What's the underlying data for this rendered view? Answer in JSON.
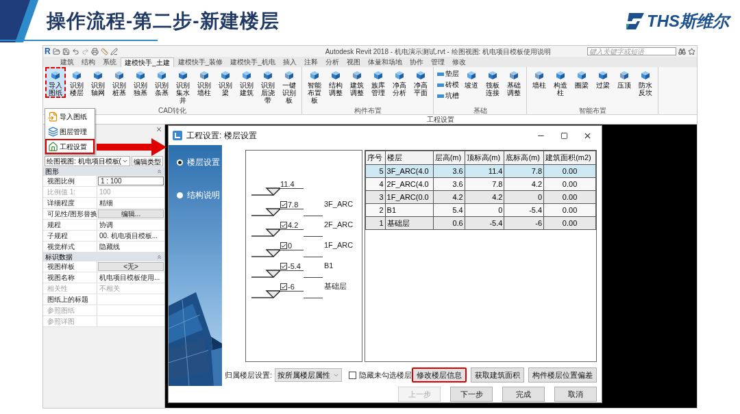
{
  "slide": {
    "title": "操作流程-第二步-新建楼层",
    "logo": "THS斯维尔"
  },
  "app": {
    "logo": "R",
    "title": "Autodesk Revit 2018 -   机电演示测试.rvt - 绘图视图: 机电项目模板使用说明",
    "search": {
      "placeholder": "键入关键字或短语"
    }
  },
  "tabs": [
    {
      "label": "建筑",
      "selected": false
    },
    {
      "label": "结构",
      "selected": false
    },
    {
      "label": "系统",
      "selected": false
    },
    {
      "label": "建模快手_土建",
      "selected": true
    },
    {
      "label": "建模快手_装修",
      "selected": false
    },
    {
      "label": "建模快手_机电",
      "selected": false
    },
    {
      "label": "插入",
      "selected": false
    },
    {
      "label": "注释",
      "selected": false
    },
    {
      "label": "分析",
      "selected": false
    },
    {
      "label": "视图",
      "selected": false
    },
    {
      "label": "体量和场地",
      "selected": false
    },
    {
      "label": "协作",
      "selected": false
    },
    {
      "label": "管理",
      "selected": false
    },
    {
      "label": "修改",
      "selected": false
    }
  ],
  "ribbon_groups": [
    {
      "label": "CAD转化",
      "buttons": [
        {
          "kind": "large",
          "label": "导入图纸",
          "highlighted": true
        },
        {
          "kind": "large",
          "label": "识别楼层",
          "highlighted": false
        },
        {
          "kind": "large",
          "label": "识别轴网",
          "highlighted": false
        },
        {
          "kind": "large",
          "label": "识别桩基",
          "highlighted": false
        },
        {
          "kind": "large",
          "label": "识别独基",
          "highlighted": false
        },
        {
          "kind": "large",
          "label": "识别条基",
          "highlighted": false
        },
        {
          "kind": "large",
          "label": "识别集水井",
          "highlighted": false
        },
        {
          "kind": "large",
          "label": "识别墙柱",
          "highlighted": false
        },
        {
          "kind": "large",
          "label": "识别梁",
          "highlighted": false
        },
        {
          "kind": "large",
          "label": "识别建筑",
          "highlighted": false
        },
        {
          "kind": "large",
          "label": "识别后浇带",
          "highlighted": false
        },
        {
          "kind": "large",
          "label": "一键识别板",
          "highlighted": false
        }
      ]
    },
    {
      "label": "构件布置",
      "buttons": [
        {
          "kind": "large",
          "label": "智能布置板",
          "highlighted": false
        },
        {
          "kind": "large",
          "label": "结构调整",
          "highlighted": false
        },
        {
          "kind": "large",
          "label": "建筑调整",
          "highlighted": false
        },
        {
          "kind": "large",
          "label": "族库管理",
          "highlighted": false
        },
        {
          "kind": "large",
          "label": "净高分析",
          "highlighted": false
        },
        {
          "kind": "large",
          "label": "净高平面",
          "highlighted": false
        }
      ]
    },
    {
      "label": "基础",
      "buttons": [
        {
          "kind": "small",
          "label": "垫层",
          "highlighted": false
        },
        {
          "kind": "small",
          "label": "砖模",
          "highlighted": false
        },
        {
          "kind": "small",
          "label": "坑槽",
          "highlighted": false
        },
        {
          "kind": "large",
          "label": "坡道",
          "highlighted": false
        },
        {
          "kind": "large",
          "label": "筏板连接",
          "highlighted": false
        },
        {
          "kind": "large",
          "label": "基础调整",
          "highlighted": false
        }
      ]
    },
    {
      "label": "智能布置",
      "buttons": [
        {
          "kind": "large",
          "label": "墙柱",
          "highlighted": false
        },
        {
          "kind": "large",
          "label": "构造柱",
          "highlighted": false
        },
        {
          "kind": "large",
          "label": "圈梁",
          "highlighted": false
        },
        {
          "kind": "large",
          "label": "过梁",
          "highlighted": false
        },
        {
          "kind": "large",
          "label": "压顶",
          "highlighted": false
        },
        {
          "kind": "large",
          "label": "防水反坎",
          "highlighted": false
        }
      ]
    }
  ],
  "options_bar": {
    "label": "工程设置"
  },
  "menu": {
    "items": [
      {
        "label": "导入图纸",
        "highlighted": false
      },
      {
        "label": "图层管理",
        "highlighted": false
      },
      {
        "label": "工程设置",
        "highlighted": true
      }
    ]
  },
  "properties": {
    "type_selector": "绘图视图: 机电项目模板(",
    "edit_type": "编辑类型",
    "sections": [
      {
        "title": "图形",
        "rows": [
          {
            "label": "视图比例",
            "value": "1 : 100",
            "kind": "field",
            "disabled": false
          },
          {
            "label": "比例值 1:",
            "value": "100",
            "kind": "text",
            "disabled": true
          },
          {
            "label": "详细程度",
            "value": "精细",
            "kind": "text",
            "disabled": false
          },
          {
            "label": "可见性/图形替换",
            "value": "编辑...",
            "kind": "button",
            "disabled": false
          },
          {
            "label": "规程",
            "value": "协调",
            "kind": "text",
            "disabled": false
          },
          {
            "label": "子规程",
            "value": "00. 机电项目模板...",
            "kind": "text",
            "disabled": false
          },
          {
            "label": "视觉样式",
            "value": "隐藏线",
            "kind": "text",
            "disabled": false
          }
        ]
      },
      {
        "title": "标识数据",
        "rows": [
          {
            "label": "视图样板",
            "value": "<无>",
            "kind": "button",
            "disabled": false
          },
          {
            "label": "视图名称",
            "value": "机电项目模板使用...",
            "kind": "text",
            "disabled": false
          },
          {
            "label": "相关性",
            "value": "不相关",
            "kind": "text",
            "disabled": true
          },
          {
            "label": "图纸上的标题",
            "kind": "text",
            "disabled": false
          },
          {
            "label": "参照图纸",
            "kind": "text",
            "disabled": true
          },
          {
            "label": "参照详图",
            "kind": "text",
            "disabled": true
          }
        ]
      }
    ]
  },
  "dialog": {
    "title": "工程设置: 楼层设置",
    "nav": [
      {
        "label": "楼层设置",
        "selected": true
      },
      {
        "label": "结构说明",
        "selected": false
      }
    ],
    "levels": [
      {
        "kind": "plain",
        "value": "11.4"
      },
      {
        "kind": "checkbox",
        "value": "7.8",
        "checked": true,
        "label": "3F_ARC"
      },
      {
        "kind": "checkbox",
        "value": "4.2",
        "checked": true,
        "label": "2F_ARC"
      },
      {
        "kind": "checkbox",
        "value": "0",
        "checked": true,
        "label": "1F_ARC"
      },
      {
        "kind": "checkbox",
        "value": "-5.4",
        "checked": true,
        "label": "B1"
      },
      {
        "kind": "checkbox",
        "value": "-6",
        "checked": true,
        "label": "基础层"
      }
    ],
    "table": {
      "columns": [
        "序号",
        "楼层",
        "层高(m)",
        "顶标高(m)",
        "底标高(m)",
        "建筑面积(m2)"
      ],
      "rows": [
        {
          "cells": [
            "5",
            "3F_ARC(4.0",
            "3.6",
            "11.4",
            "7.8",
            "0.00"
          ],
          "selected": true
        },
        {
          "cells": [
            "4",
            "2F_ARC(4.0",
            "3.6",
            "7.8",
            "4.2",
            "0.00"
          ],
          "selected": false
        },
        {
          "cells": [
            "3",
            "1F_ARC(0.0",
            "4.2",
            "4.2",
            "0",
            "0.00"
          ],
          "selected": false
        },
        {
          "cells": [
            "2",
            "B1",
            "5.4",
            "0",
            "-5.4",
            "0.00"
          ],
          "selected": false
        },
        {
          "cells": [
            "1",
            "基础层",
            "0.6",
            "-5.4",
            "-6",
            "0.00"
          ],
          "selected": false
        }
      ]
    },
    "assign_label": "归属楼层设置:",
    "assign_value": "按所属楼层属性",
    "hide_unchecked": {
      "label": "隐藏未勾选楼层",
      "checked": false
    },
    "action_buttons": [
      {
        "label": "修改楼层信息",
        "highlighted": true
      },
      {
        "label": "获取建筑面积",
        "highlighted": false
      },
      {
        "label": "构件楼层位置偏差",
        "highlighted": false
      }
    ],
    "nav_buttons": [
      {
        "label": "上一步",
        "disabled": true
      },
      {
        "label": "下一步",
        "disabled": false
      },
      {
        "label": "完成",
        "disabled": false
      },
      {
        "label": "取消",
        "disabled": false
      }
    ]
  }
}
